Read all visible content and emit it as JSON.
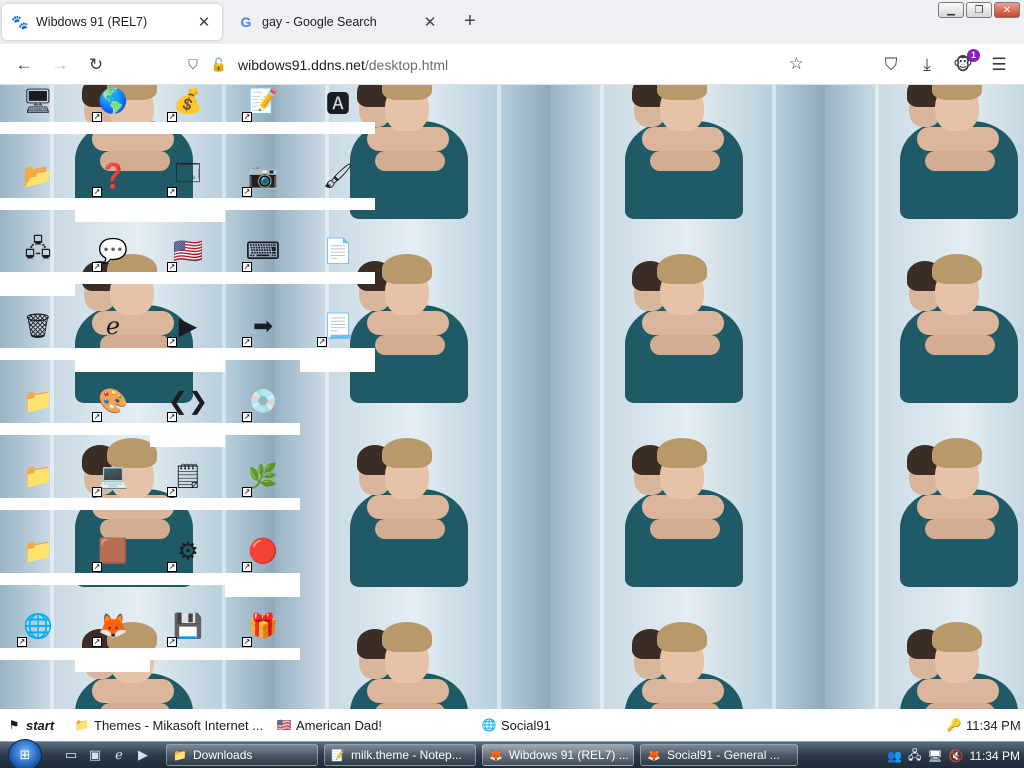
{
  "browser": {
    "tabs": [
      {
        "title": "Wibdows 91 (REL7)",
        "active": true,
        "favicon": "wibdows-favicon-icon"
      },
      {
        "title": "gay - Google Search",
        "active": false,
        "favicon": "google-favicon-icon"
      }
    ],
    "url_host": "wibdows91.ddns.net",
    "url_path": "/desktop.html",
    "extension_badge": "1"
  },
  "desktop_icons": [
    {
      "name": "my-computer-icon",
      "glyph": "🖥",
      "shortcut": false
    },
    {
      "name": "internet-globe-icon",
      "glyph": "🌎",
      "shortcut": true
    },
    {
      "name": "money-bag-icon",
      "glyph": "💰",
      "shortcut": true
    },
    {
      "name": "notepad-icon",
      "glyph": "📝",
      "shortcut": true
    },
    {
      "name": "font-icon",
      "glyph": "🅰",
      "shortcut": false
    },
    {
      "name": "folder-open-icon",
      "glyph": "📂",
      "shortcut": false
    },
    {
      "name": "help-icon",
      "glyph": "❓",
      "shortcut": true
    },
    {
      "name": "window-app-icon",
      "glyph": "🗔",
      "shortcut": true
    },
    {
      "name": "camera-icon",
      "glyph": "📷",
      "shortcut": true
    },
    {
      "name": "paint-document-icon",
      "glyph": "🖌",
      "shortcut": false
    },
    {
      "name": "network-computers-icon",
      "glyph": "🖧",
      "shortcut": false
    },
    {
      "name": "chat-bubble-icon",
      "glyph": "💬",
      "shortcut": true
    },
    {
      "name": "us-flag-icon",
      "glyph": "🇺🇸",
      "shortcut": true
    },
    {
      "name": "keyboard-icon",
      "glyph": "⌨",
      "shortcut": true
    },
    {
      "name": "text-document-icon",
      "glyph": "📄",
      "shortcut": false
    },
    {
      "name": "recycle-bin-icon",
      "glyph": "🗑",
      "shortcut": false
    },
    {
      "name": "ie-logo-icon",
      "glyph": "ℯ",
      "shortcut": false
    },
    {
      "name": "media-player-icon",
      "glyph": "▶",
      "shortcut": true
    },
    {
      "name": "red-arrow-icon",
      "glyph": "➡",
      "shortcut": true
    },
    {
      "name": "ie-document-icon",
      "glyph": "📃",
      "shortcut": true
    },
    {
      "name": "folder-icon-1",
      "glyph": "📁",
      "shortcut": false
    },
    {
      "name": "paint-tools-icon",
      "glyph": "🎨",
      "shortcut": true
    },
    {
      "name": "vscode-icon",
      "glyph": "❮❯",
      "shortcut": true
    },
    {
      "name": "disc-icon",
      "glyph": "💿",
      "shortcut": true
    },
    {
      "name": "folder-icon-2",
      "glyph": "📁",
      "shortcut": false
    },
    {
      "name": "computer-old-icon",
      "glyph": "💻",
      "shortcut": true
    },
    {
      "name": "notes-icon",
      "glyph": "🗒",
      "shortcut": true
    },
    {
      "name": "grass-image-icon",
      "glyph": "🌿",
      "shortcut": true
    },
    {
      "name": "folder-icon-3",
      "glyph": "📁",
      "shortcut": false
    },
    {
      "name": "minecraft-block-icon",
      "glyph": "🟫",
      "shortcut": true
    },
    {
      "name": "gear-icon",
      "glyph": "⚙",
      "shortcut": true
    },
    {
      "name": "colorful-ball-icon",
      "glyph": "🔴",
      "shortcut": true
    },
    {
      "name": "network-globe-icon",
      "glyph": "🌐",
      "shortcut": true
    },
    {
      "name": "fox-icon",
      "glyph": "🦊",
      "shortcut": true
    },
    {
      "name": "usb-drive-icon",
      "glyph": "💾",
      "shortcut": true
    },
    {
      "name": "gift-box-icon",
      "glyph": "🎁",
      "shortcut": true
    }
  ],
  "inner_taskbar": {
    "start_label": "start",
    "items": [
      {
        "label": "Themes - Mikasoft Internet ...",
        "icon": "folder-icon"
      },
      {
        "label": "American Dad!",
        "icon": "us-flag-icon"
      },
      {
        "label": "Social91",
        "icon": "globe-icon"
      }
    ],
    "clock": "11:34 PM"
  },
  "win7_taskbar": {
    "buttons": [
      {
        "label": "Downloads",
        "icon": "folder-icon"
      },
      {
        "label": "milk.theme - Notep...",
        "icon": "notepad-icon"
      },
      {
        "label": "Wibdows 91 (REL7) ...",
        "icon": "firefox-icon",
        "active": true
      },
      {
        "label": "Social91 - General ...",
        "icon": "firefox-icon"
      }
    ],
    "clock": "11:34 PM"
  },
  "colors": {
    "accent_purple": "#8a1ec0",
    "tab_bg": "#f0f0f4",
    "win7_taskbar": "#2c3a4a"
  }
}
